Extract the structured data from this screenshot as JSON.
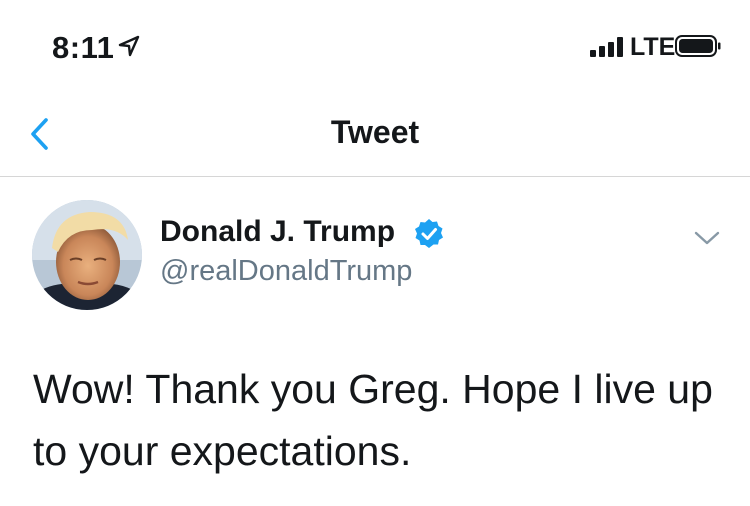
{
  "status_bar": {
    "time": "8:11",
    "network": "LTE",
    "location_icon": "location-arrow-icon",
    "signal_icon": "signal-bars-icon",
    "battery_icon": "battery-icon"
  },
  "nav": {
    "back_icon": "chevron-left-icon",
    "title": "Tweet"
  },
  "tweet": {
    "author": {
      "display_name": "Donald J. Trump",
      "handle": "@realDonaldTrump",
      "verified": true,
      "verified_icon": "verified-badge-icon"
    },
    "menu_icon": "chevron-down-icon",
    "text": "Wow! Thank you Greg. Hope I live up to your expectations."
  },
  "colors": {
    "accent": "#1da1f2",
    "text": "#14171a",
    "secondary_text": "#657786",
    "divider": "#d6d6d6"
  }
}
